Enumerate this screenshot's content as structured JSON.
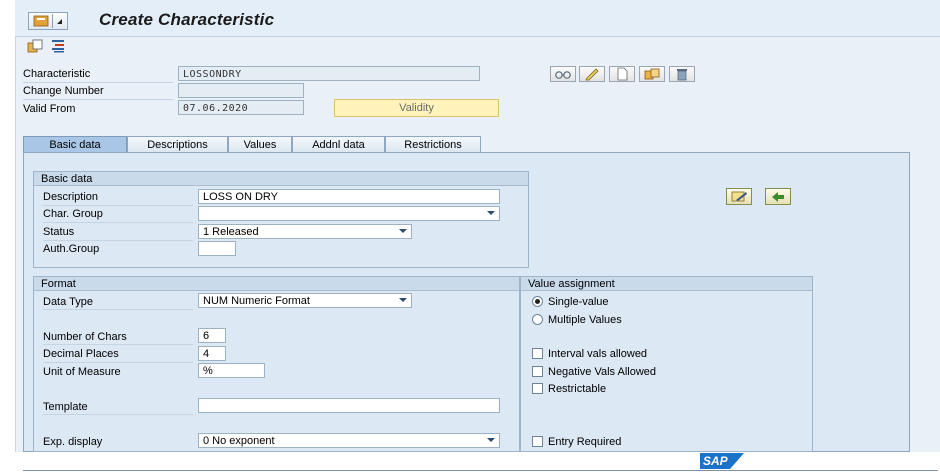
{
  "header": {
    "title": "Create Characteristic"
  },
  "fields": {
    "characteristic_label": "Characteristic",
    "characteristic_value": "LOSSONDRY",
    "change_number_label": "Change Number",
    "change_number_value": "",
    "valid_from_label": "Valid From",
    "valid_from_value": "07.06.2020",
    "validity_button": "Validity"
  },
  "tabs": [
    {
      "label": "Basic data",
      "active": true
    },
    {
      "label": "Descriptions"
    },
    {
      "label": "Values"
    },
    {
      "label": "Addnl data"
    },
    {
      "label": "Restrictions"
    }
  ],
  "basic_data": {
    "heading": "Basic data",
    "description_label": "Description",
    "description_value": "LOSS ON DRY",
    "char_group_label": "Char. Group",
    "char_group_value": "",
    "status_label": "Status",
    "status_value": "1 Released",
    "auth_group_label": "Auth.Group",
    "auth_group_value": ""
  },
  "format": {
    "heading": "Format",
    "data_type_label": "Data Type",
    "data_type_value": "NUM Numeric Format",
    "num_chars_label": "Number of Chars",
    "num_chars_value": "6",
    "decimal_places_label": "Decimal Places",
    "decimal_places_value": "4",
    "unit_label": "Unit of Measure",
    "unit_value": "%",
    "template_label": "Template",
    "template_value": "",
    "exp_display_label": "Exp. display",
    "exp_display_value": "0 No exponent"
  },
  "value_assignment": {
    "heading": "Value assignment",
    "single_value_label": "Single-value",
    "multiple_values_label": "Multiple Values",
    "interval_label": "Interval vals allowed",
    "negative_label": "Negative Vals Allowed",
    "restrictable_label": "Restrictable",
    "entry_required_label": "Entry Required"
  },
  "footer": {
    "logo_text": "SAP"
  },
  "colors": {
    "accent": "#a9c6e6",
    "validity_bg": "#fff3bb",
    "panel": "#dce8f4"
  }
}
